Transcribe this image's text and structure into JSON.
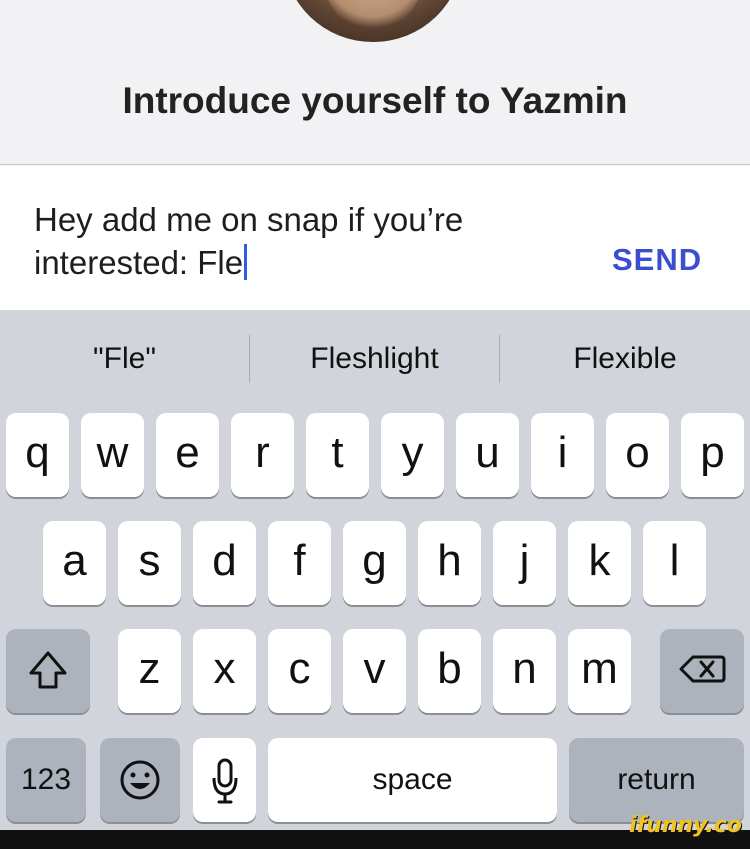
{
  "header": {
    "title": "Introduce yourself to Yazmin"
  },
  "composer": {
    "message": "Hey add me on snap if you’re interested: Fle",
    "send_label": "SEND"
  },
  "suggestions": [
    "\"Fle\"",
    "Fleshlight",
    "Flexible"
  ],
  "keyboard": {
    "row1": [
      "q",
      "w",
      "e",
      "r",
      "t",
      "y",
      "u",
      "i",
      "o",
      "p"
    ],
    "row2": [
      "a",
      "s",
      "d",
      "f",
      "g",
      "h",
      "j",
      "k",
      "l"
    ],
    "row3": [
      "z",
      "x",
      "c",
      "v",
      "b",
      "n",
      "m"
    ],
    "numbers_label": "123",
    "space_label": "space",
    "return_label": "return",
    "icons": {
      "shift": "shift-icon",
      "delete": "delete-icon",
      "emoji": "emoji-icon",
      "mic": "microphone-icon"
    }
  },
  "watermark": "ifunny.co",
  "colors": {
    "accent": "#3b4ed0",
    "caret": "#2e5ce6",
    "keyboard_bg": "#d1d4da",
    "key_bg": "#ffffff",
    "dark_key_bg": "#adb3bc"
  }
}
